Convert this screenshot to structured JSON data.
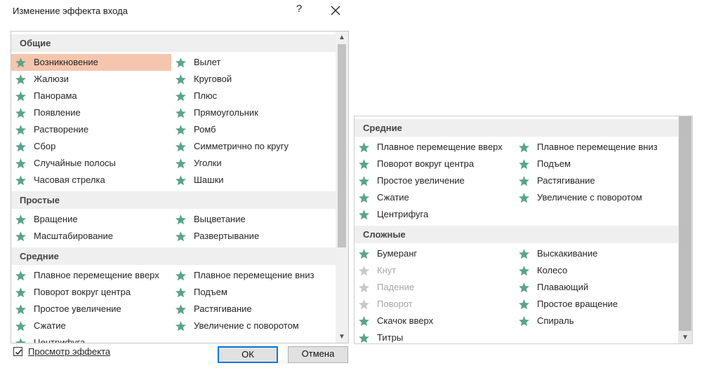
{
  "dialog": {
    "title": "Изменение эффекта входа",
    "help_label": "?",
    "preview_label": "Просмотр эффекта",
    "preview_checked": true,
    "ok_label": "ОК",
    "cancel_label": "Отмена"
  },
  "colors": {
    "star_enabled": "#5aa48a",
    "star_disabled": "#c8c8c8",
    "selected_bg": "#f6c5ad",
    "group_header_bg": "#efefef",
    "ok_border": "#0078d7"
  },
  "main_list": {
    "groups": [
      {
        "header": "Общие",
        "items": [
          {
            "label": "Возникновение",
            "selected": true
          },
          {
            "label": "Вылет"
          },
          {
            "label": "Жалюзи"
          },
          {
            "label": "Круговой"
          },
          {
            "label": "Панорама"
          },
          {
            "label": "Плюс"
          },
          {
            "label": "Появление"
          },
          {
            "label": "Прямоугольник"
          },
          {
            "label": "Растворение"
          },
          {
            "label": "Ромб"
          },
          {
            "label": "Сбор"
          },
          {
            "label": "Симметрично по кругу"
          },
          {
            "label": "Случайные полосы"
          },
          {
            "label": "Уголки"
          },
          {
            "label": "Часовая стрелка"
          },
          {
            "label": "Шашки"
          }
        ]
      },
      {
        "header": "Простые",
        "items": [
          {
            "label": "Вращение"
          },
          {
            "label": "Выцветание"
          },
          {
            "label": "Масштабирование"
          },
          {
            "label": "Развертывание"
          }
        ]
      },
      {
        "header": "Средние",
        "items": [
          {
            "label": "Плавное перемещение вверх"
          },
          {
            "label": "Плавное перемещение вниз"
          },
          {
            "label": "Поворот вокруг центра"
          },
          {
            "label": "Подъем"
          },
          {
            "label": "Простое увеличение"
          },
          {
            "label": "Растягивание"
          },
          {
            "label": "Сжатие"
          },
          {
            "label": "Увеличение с поворотом"
          },
          {
            "label": "Центрифуга"
          }
        ]
      }
    ]
  },
  "scrolled_list": {
    "groups": [
      {
        "header": "Средние",
        "items": [
          {
            "label": "Плавное перемещение вверх"
          },
          {
            "label": "Плавное перемещение вниз"
          },
          {
            "label": "Поворот вокруг центра"
          },
          {
            "label": "Подъем"
          },
          {
            "label": "Простое увеличение"
          },
          {
            "label": "Растягивание"
          },
          {
            "label": "Сжатие"
          },
          {
            "label": "Увеличение с поворотом"
          },
          {
            "label": "Центрифуга"
          }
        ]
      },
      {
        "header": "Сложные",
        "items": [
          {
            "label": "Бумеранг"
          },
          {
            "label": "Выскакивание"
          },
          {
            "label": "Кнут",
            "disabled": true
          },
          {
            "label": "Колесо"
          },
          {
            "label": "Падение",
            "disabled": true
          },
          {
            "label": "Плавающий"
          },
          {
            "label": "Поворот",
            "disabled": true
          },
          {
            "label": "Простое вращение"
          },
          {
            "label": "Скачок вверх"
          },
          {
            "label": "Спираль"
          },
          {
            "label": "Титры"
          }
        ]
      }
    ]
  }
}
